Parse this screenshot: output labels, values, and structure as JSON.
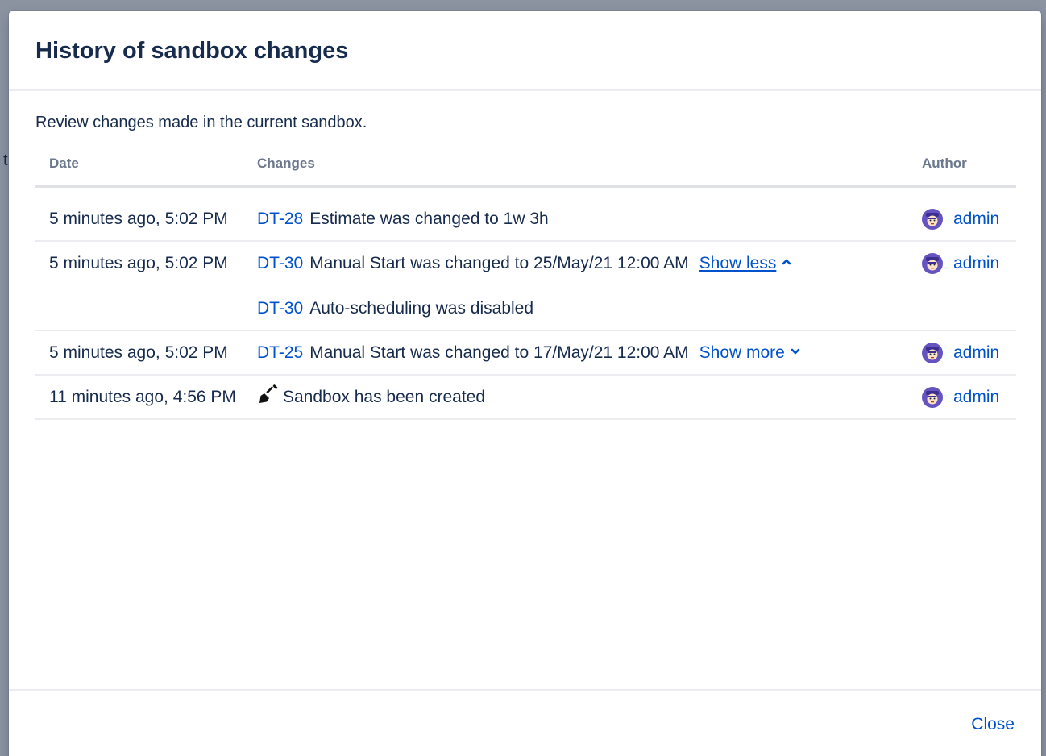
{
  "modal": {
    "title": "History of sandbox changes",
    "intro": "Review changes made in the current sandbox.",
    "close_label": "Close"
  },
  "table": {
    "headers": {
      "date": "Date",
      "changes": "Changes",
      "author": "Author"
    },
    "rows": [
      {
        "date": "5 minutes ago, 5:02 PM",
        "changes": [
          {
            "issue": "DT-28",
            "text": "Estimate was changed to 1w 3h"
          }
        ],
        "author": "admin"
      },
      {
        "date": "5 minutes ago, 5:02 PM",
        "changes": [
          {
            "issue": "DT-30",
            "text": "Manual Start was changed to 25/May/21 12:00 AM",
            "toggle": "Show less"
          },
          {
            "issue": "DT-30",
            "text": "Auto-scheduling was disabled"
          }
        ],
        "author": "admin"
      },
      {
        "date": "5 minutes ago, 5:02 PM",
        "changes": [
          {
            "issue": "DT-25",
            "text": "Manual Start was changed to 17/May/21 12:00 AM",
            "toggle": "Show more"
          }
        ],
        "author": "admin"
      },
      {
        "date": "11 minutes ago, 4:56 PM",
        "changes": [
          {
            "icon": "shovel-icon",
            "text": "Sandbox has been created"
          }
        ],
        "author": "admin"
      }
    ]
  },
  "colors": {
    "link": "#0052cc",
    "text": "#172b4d",
    "header_text": "#6b778c",
    "avatar": "#6554c0"
  }
}
